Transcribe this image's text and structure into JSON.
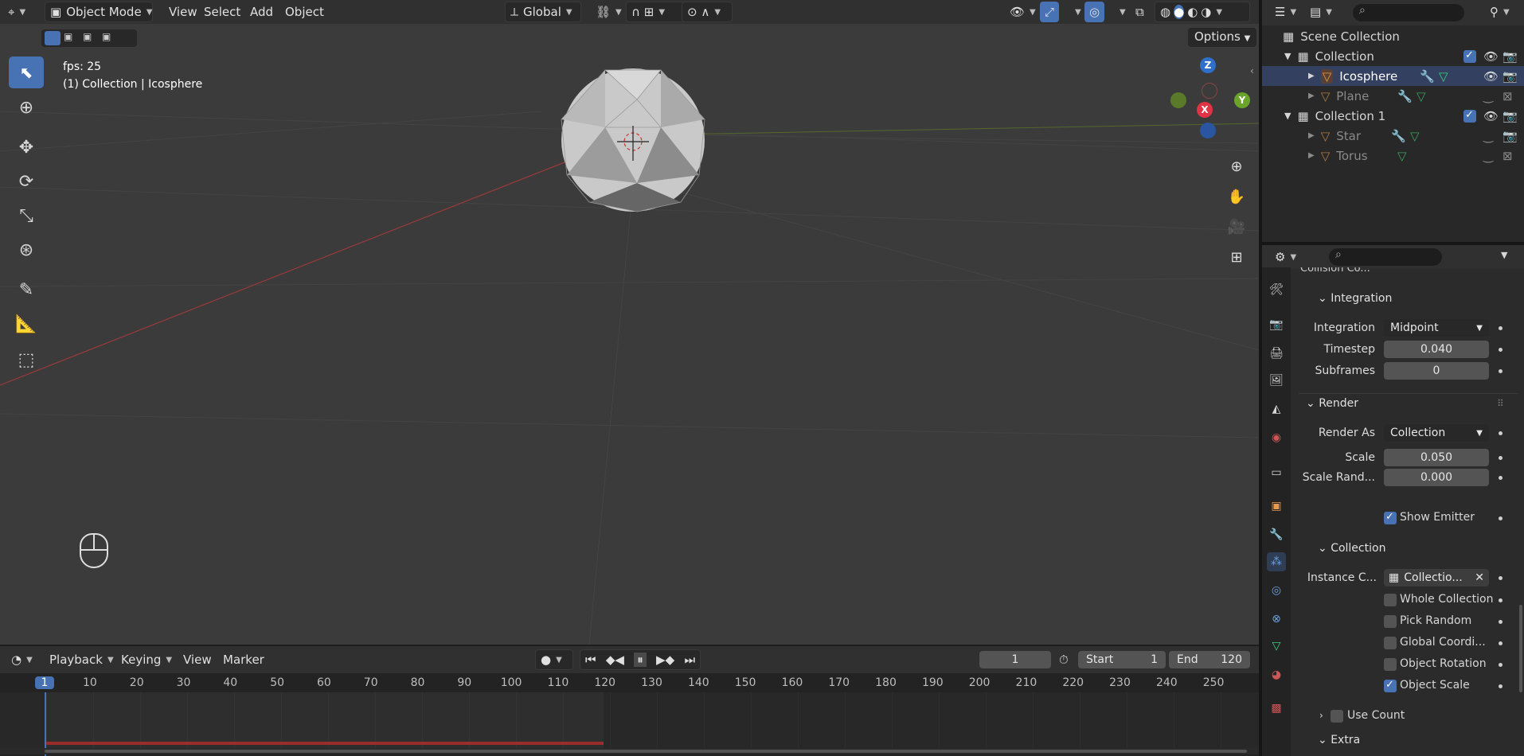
{
  "header": {
    "mode": "Object Mode",
    "menus": [
      "View",
      "Select",
      "Add",
      "Object"
    ],
    "transform_orientation": "Global",
    "options_label": "Options"
  },
  "viewport": {
    "fps_text": "fps: 25",
    "active_text": "(1) Collection | Icosphere",
    "gizmo": {
      "z": "Z",
      "x": "X",
      "y": "Y"
    }
  },
  "timeline": {
    "menus": [
      "Playback",
      "Keying",
      "View",
      "Marker"
    ],
    "current_frame": "1",
    "start_label": "Start",
    "start_value": "1",
    "end_label": "End",
    "end_value": "120",
    "ruler": [
      "1",
      "10",
      "20",
      "30",
      "40",
      "50",
      "60",
      "70",
      "80",
      "90",
      "100",
      "110",
      "120",
      "130",
      "140",
      "150",
      "160",
      "170",
      "180",
      "190",
      "200",
      "210",
      "220",
      "230",
      "240",
      "250"
    ]
  },
  "outliner": {
    "rows": [
      {
        "label": "Scene Collection"
      },
      {
        "label": "Collection"
      },
      {
        "label": "Icosphere"
      },
      {
        "label": "Plane"
      },
      {
        "label": "Collection 1"
      },
      {
        "label": "Star"
      },
      {
        "label": "Torus"
      }
    ]
  },
  "properties": {
    "cut_label": "Collision Co...",
    "integration_section": "Integration",
    "integration_label": "Integration",
    "integration_value": "Midpoint",
    "timestep_label": "Timestep",
    "timestep_value": "0.040",
    "subframes_label": "Subframes",
    "subframes_value": "0",
    "render_section": "Render",
    "render_as_label": "Render As",
    "render_as_value": "Collection",
    "scale_label": "Scale",
    "scale_value": "0.050",
    "scale_random_label": "Scale Rand...",
    "scale_random_value": "0.000",
    "show_emitter": "Show Emitter",
    "collection_section": "Collection",
    "instance_label": "Instance C...",
    "instance_value": "Collectio...",
    "whole_collection": "Whole Collection",
    "pick_random": "Pick Random",
    "global_coords": "Global Coordi...",
    "object_rotation": "Object Rotation",
    "object_scale": "Object Scale",
    "use_count": "Use Count",
    "extra_section": "Extra"
  }
}
